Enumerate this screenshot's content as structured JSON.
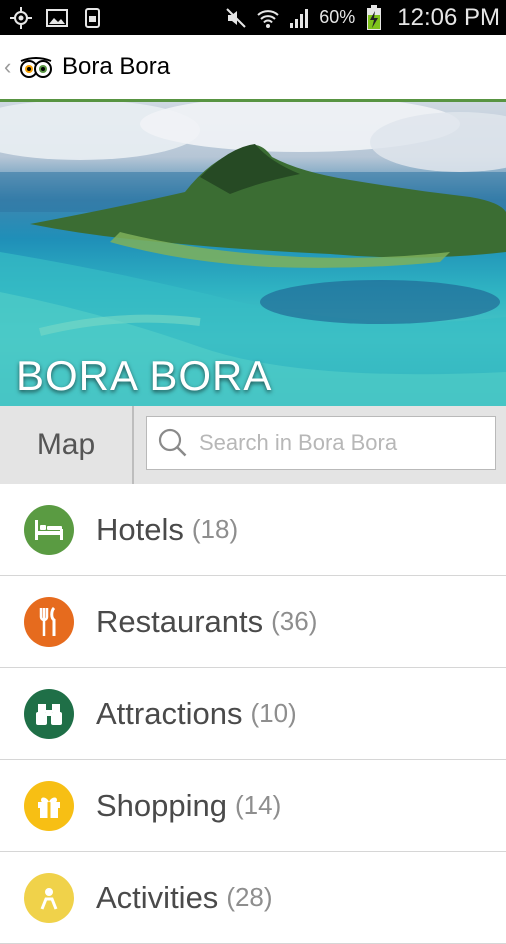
{
  "status_bar": {
    "battery": "60%",
    "time": "12:06 PM"
  },
  "action_bar": {
    "title": "Bora Bora"
  },
  "hero": {
    "title": "BORA BORA"
  },
  "search": {
    "map_label": "Map",
    "placeholder": "Search in Bora Bora"
  },
  "categories": [
    {
      "label": "Hotels",
      "count": "(18)",
      "icon": "bed-icon",
      "color": "#5a9b42"
    },
    {
      "label": "Restaurants",
      "count": "(36)",
      "icon": "fork-knife-icon",
      "color": "#e66b1e"
    },
    {
      "label": "Attractions",
      "count": "(10)",
      "icon": "binoculars-icon",
      "color": "#1f6f47"
    },
    {
      "label": "Shopping",
      "count": "(14)",
      "icon": "gift-icon",
      "color": "#f7bf14"
    },
    {
      "label": "Activities",
      "count": "(28)",
      "icon": "activities-icon",
      "color": "#f0d24a"
    }
  ],
  "colors": {
    "accent_green": "#589442",
    "status_bar_bg": "#000000"
  }
}
